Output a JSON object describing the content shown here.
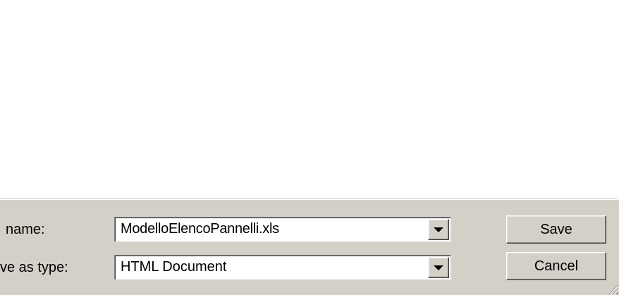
{
  "dialog": {
    "file_name_label": " name:",
    "save_as_type_label": "ve as type:",
    "file_name_value": "ModelloElencoPannelli.xls",
    "save_as_type_value": "HTML Document",
    "save_button": "Save",
    "cancel_button": "Cancel"
  },
  "icons": {
    "dropdown": "chevron-down-icon",
    "resize": "resize-grip-icon"
  },
  "colors": {
    "dialog_bg": "#d4d0c8",
    "list_bg": "#ffffff"
  }
}
